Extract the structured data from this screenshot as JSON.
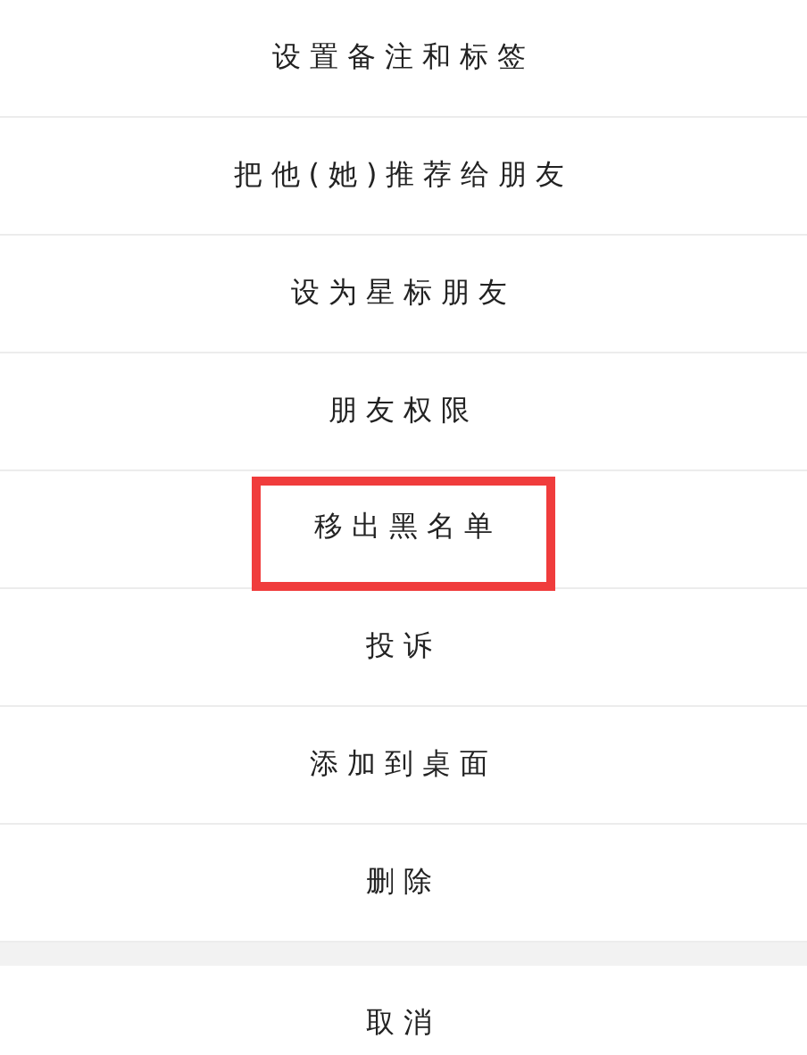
{
  "menu": {
    "items": [
      {
        "label": "设置备注和标签",
        "highlighted": false
      },
      {
        "label": "把他(她)推荐给朋友",
        "highlighted": false
      },
      {
        "label": "设为星标朋友",
        "highlighted": false
      },
      {
        "label": "朋友权限",
        "highlighted": false
      },
      {
        "label": "移出黑名单",
        "highlighted": true
      },
      {
        "label": "投诉",
        "highlighted": false
      },
      {
        "label": "添加到桌面",
        "highlighted": false
      },
      {
        "label": "删除",
        "highlighted": false
      }
    ]
  },
  "cancel": {
    "label": "取消"
  }
}
